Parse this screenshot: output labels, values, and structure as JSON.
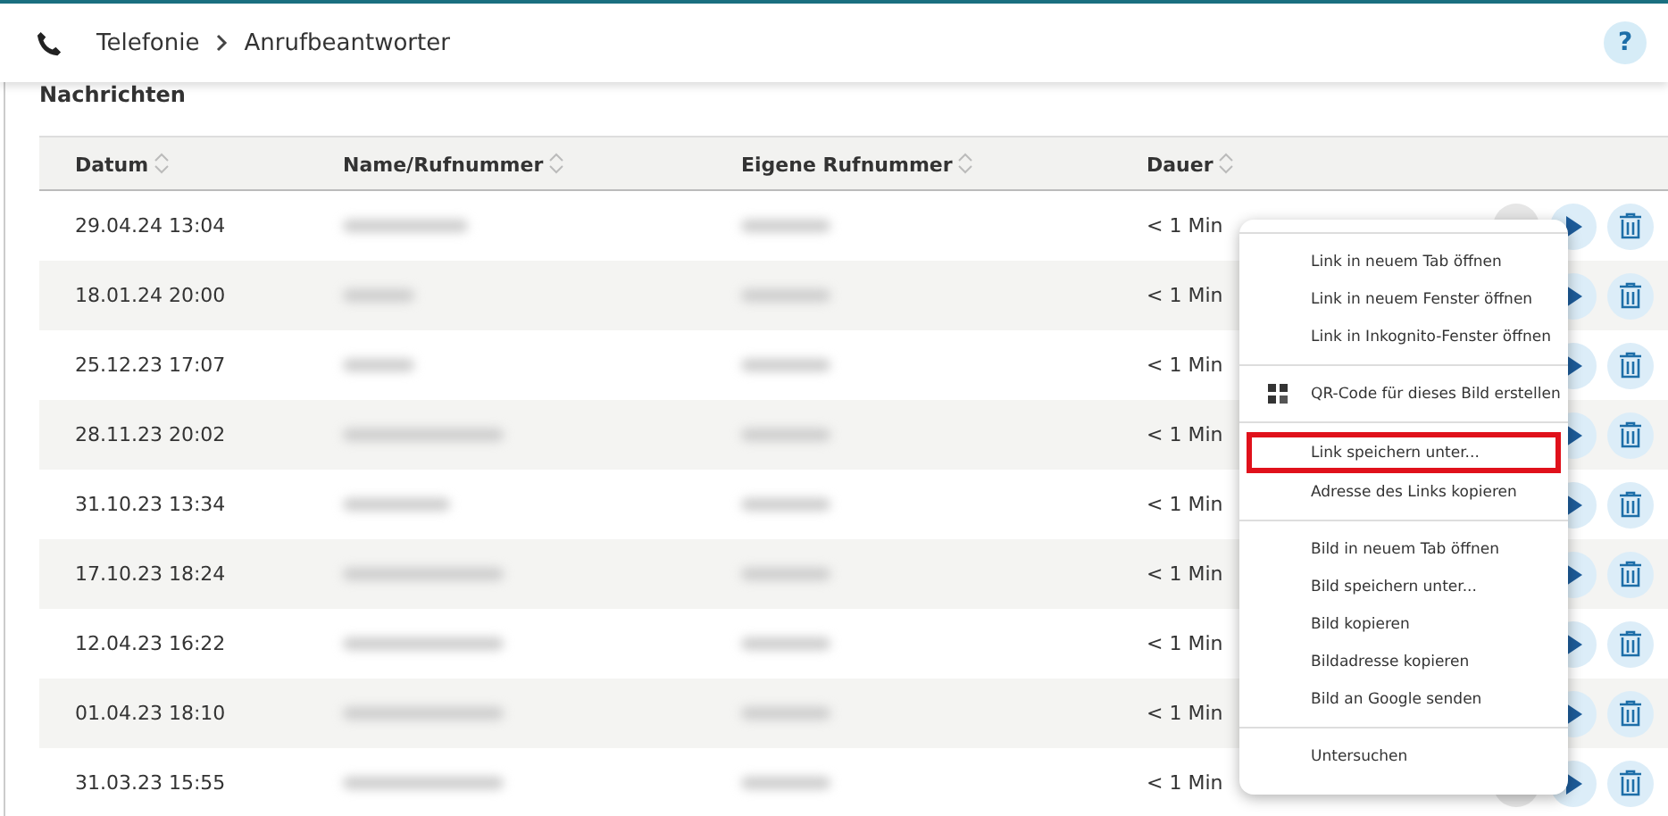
{
  "header": {
    "breadcrumb": [
      "Telefonie",
      "Anrufbeantworter"
    ],
    "help": "?"
  },
  "section_title": "Nachrichten",
  "table": {
    "columns": [
      "Datum",
      "Name/Rufnummer",
      "Eigene Rufnummer",
      "Dauer"
    ],
    "rows": [
      {
        "date": "29.04.24 13:04",
        "download_shown": true,
        "name_blurred": true,
        "number_blurred": true,
        "duration": "< 1 Min"
      },
      {
        "date": "18.01.24 20:00",
        "name_blurred": true,
        "number_blurred": true,
        "duration": "< 1 Min"
      },
      {
        "date": "25.12.23 17:07",
        "name_blurred": true,
        "number_blurred": true,
        "duration": "< 1 Min"
      },
      {
        "date": "28.11.23 20:02",
        "name_blurred": true,
        "number_blurred": true,
        "duration": "< 1 Min"
      },
      {
        "date": "31.10.23 13:34",
        "name_blurred": true,
        "number_blurred": true,
        "duration": "< 1 Min"
      },
      {
        "date": "17.10.23 18:24",
        "name_blurred": true,
        "number_blurred": true,
        "duration": "< 1 Min"
      },
      {
        "date": "12.04.23 16:22",
        "name_blurred": true,
        "number_blurred": true,
        "duration": "< 1 Min"
      },
      {
        "date": "01.04.23 18:10",
        "name_blurred": true,
        "number_blurred": true,
        "duration": "< 1 Min"
      },
      {
        "date": "31.03.23 15:55",
        "download_shown": true,
        "name_blurred": true,
        "number_blurred": true,
        "duration": "< 1 Min"
      }
    ]
  },
  "context_menu": {
    "groups": [
      {
        "items": [
          {
            "label": "Link in neuem Tab öffnen",
            "kind": "plain",
            "highlighted": false
          },
          {
            "label": "Link in neuem Fenster öffnen",
            "kind": "plain",
            "highlighted": false
          },
          {
            "label": "Link in Inkognito-Fenster öffnen",
            "kind": "plain",
            "highlighted": false
          }
        ]
      },
      {
        "items": [
          {
            "label": "QR-Code für dieses Bild erstellen",
            "kind": "qr",
            "highlighted": false
          }
        ]
      },
      {
        "items": [
          {
            "label": "Link speichern unter...",
            "kind": "plain",
            "highlighted": true
          },
          {
            "label": "Adresse des Links kopieren",
            "kind": "plain",
            "highlighted": false
          }
        ]
      },
      {
        "items": [
          {
            "label": "Bild in neuem Tab öffnen",
            "kind": "plain",
            "highlighted": false
          },
          {
            "label": "Bild speichern unter...",
            "kind": "plain",
            "highlighted": false
          },
          {
            "label": "Bild kopieren",
            "kind": "plain",
            "highlighted": false
          },
          {
            "label": "Bildadresse kopieren",
            "kind": "plain",
            "highlighted": false
          },
          {
            "label": "Bild an Google senden",
            "kind": "plain",
            "highlighted": false
          }
        ]
      },
      {
        "items": [
          {
            "label": "Untersuchen",
            "kind": "plain",
            "highlighted": false
          }
        ]
      }
    ]
  }
}
